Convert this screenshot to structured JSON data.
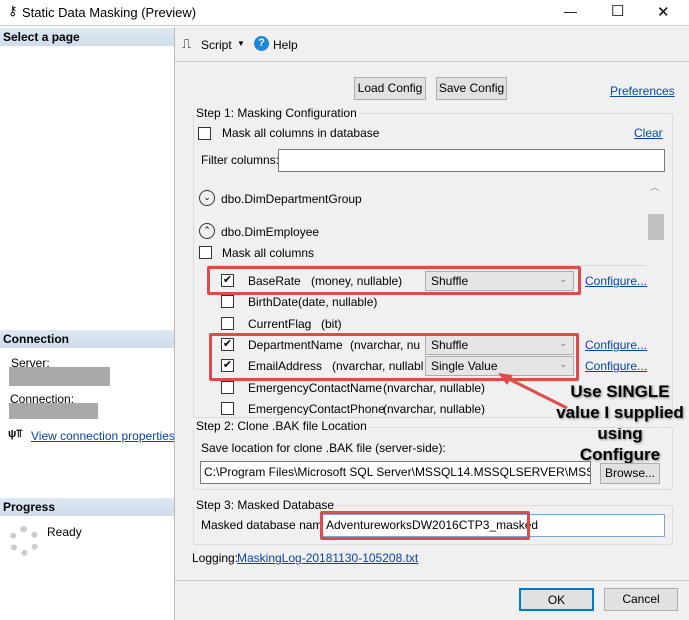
{
  "window": {
    "title": "Static Data Masking (Preview)",
    "minimize": "—",
    "maximize": "☐",
    "close": "✕"
  },
  "left": {
    "select_page": "Select a page",
    "connection_header": "Connection",
    "server_label": "Server:",
    "connection_label": "Connection:",
    "view_connection": "View connection properties",
    "progress_header": "Progress",
    "progress_status": "Ready"
  },
  "toolbar": {
    "script": "Script",
    "help": "Help"
  },
  "top_buttons": {
    "load": "Load Config",
    "save": "Save Config",
    "preferences": "Preferences"
  },
  "step1": {
    "title": "Step 1: Masking Configuration",
    "mask_all_db": "Mask all columns in database",
    "clear": "Clear",
    "filter_label": "Filter columns:",
    "filter_value": "",
    "tables": [
      {
        "name": "dbo.DimDepartmentGroup",
        "expanded": false
      },
      {
        "name": "dbo.DimEmployee",
        "expanded": true
      }
    ],
    "mask_all_columns": "Mask all columns",
    "columns": [
      {
        "name": "BaseRate",
        "type": "(money, nullable)",
        "checked": true,
        "mask": "Shuffle",
        "configure": "Configure..."
      },
      {
        "name": "BirthDate",
        "type": "(date, nullable)",
        "checked": false
      },
      {
        "name": "CurrentFlag",
        "type": "(bit)",
        "checked": false
      },
      {
        "name": "DepartmentName",
        "type": "(nvarchar, nu",
        "checked": true,
        "mask": "Shuffle",
        "configure": "Configure..."
      },
      {
        "name": "EmailAddress",
        "type": "(nvarchar, nullabl",
        "checked": true,
        "mask": "Single Value",
        "configure": "Configure..."
      },
      {
        "name": "EmergencyContactName",
        "type": "(nvarchar, nullable)",
        "checked": false
      },
      {
        "name": "EmergencyContactPhone",
        "type": "(nvarchar, nullable)",
        "checked": false
      }
    ]
  },
  "annotation": {
    "line1": "Use SINGLE",
    "line2": "value I supplied",
    "line3": "using",
    "line4": "Configure",
    "color": "#e04a4a"
  },
  "step2": {
    "title": "Step 2: Clone .BAK file Location",
    "label": "Save location for clone .BAK file (server-side):",
    "path": "C:\\Program Files\\Microsoft SQL Server\\MSSQL14.MSSQLSERVER\\MSSQL\\DATA",
    "browse": "Browse..."
  },
  "step3": {
    "title": "Step 3: Masked Database",
    "label": "Masked database name:",
    "value": "AdventureworksDW2016CTP3_masked"
  },
  "logging": {
    "label": "Logging:",
    "file": "MaskingLog-20181130-105208.txt"
  },
  "footer": {
    "ok": "OK",
    "cancel": "Cancel"
  }
}
